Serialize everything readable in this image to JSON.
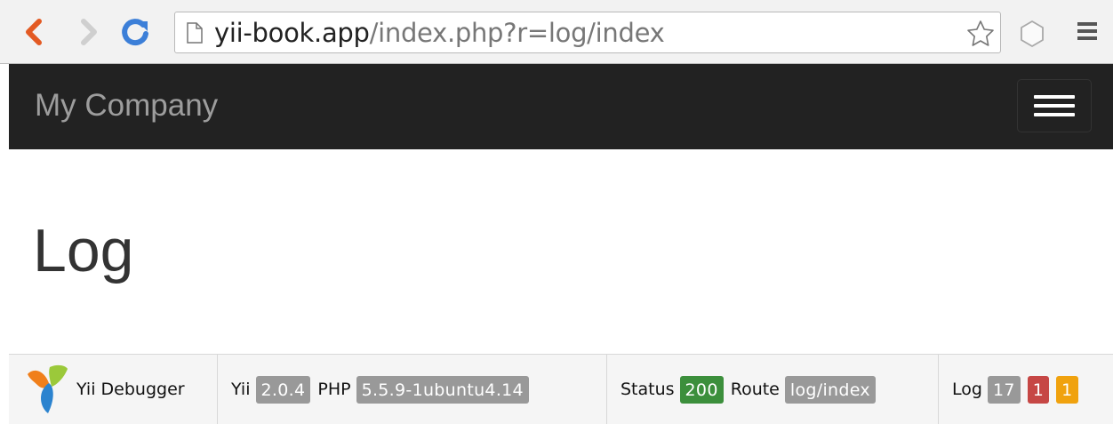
{
  "browser": {
    "url_domain": "yii-book.app",
    "url_path": "/index.php?r=log/index",
    "icons": {
      "back": "back-arrow-icon",
      "forward": "forward-arrow-icon",
      "reload": "reload-icon",
      "page": "page-icon",
      "star": "star-icon",
      "extension": "extension-icon",
      "menu": "hamburger-menu-icon"
    },
    "colors": {
      "back": "#e35a23",
      "reload": "#3c7fd8",
      "forward": "#cfcfcf"
    }
  },
  "navbar": {
    "brand": "My Company",
    "toggle_icon": "hamburger-menu-icon",
    "colors": {
      "background": "#222222",
      "brand": "#9d9d9d"
    }
  },
  "main": {
    "title": "Log"
  },
  "debug_toolbar": {
    "logo_icon": "yii-logo-icon",
    "name": "Yii Debugger",
    "yii_label": "Yii",
    "yii_version": "2.0.4",
    "php_label": "PHP",
    "php_version": "5.5.9-1ubuntu4.14",
    "status_label": "Status",
    "status_code": "200",
    "route_label": "Route",
    "route": "log/index",
    "log_label": "Log",
    "log_total": "17",
    "log_errors": "1",
    "log_warnings": "1",
    "colors": {
      "grey": "#999999",
      "success": "#3c8f3c",
      "error": "#c64745",
      "warning": "#f0a20e"
    }
  }
}
